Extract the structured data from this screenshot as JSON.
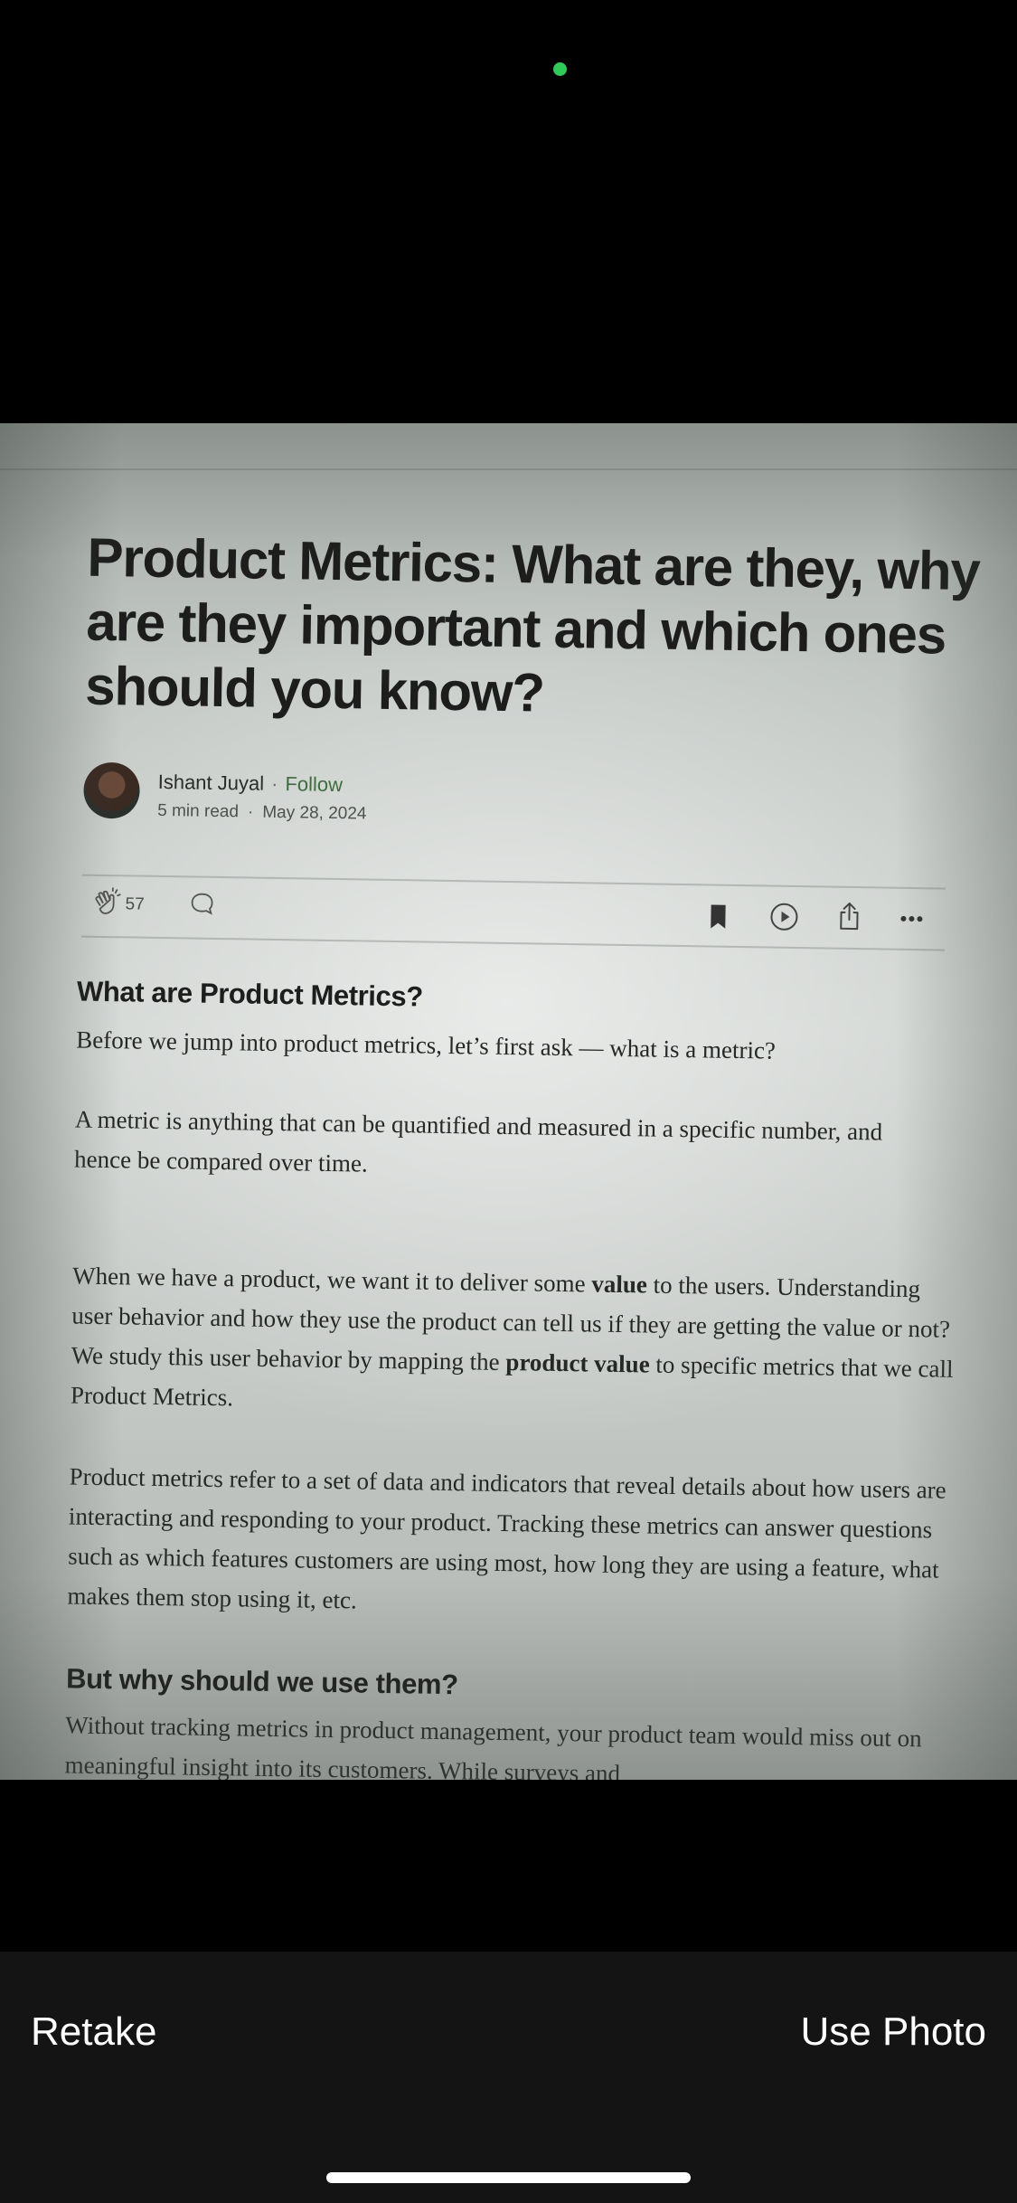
{
  "camera": {
    "indicator": "camera-in-use-indicator"
  },
  "article": {
    "title": "Product Metrics: What are they, why are they important and which ones should you know?",
    "author": "Ishant Juyal",
    "separator": "·",
    "follow_label": "Follow",
    "read_time": "5 min read",
    "date": "May 28, 2024",
    "clap_count": "57",
    "icons": {
      "clap": "clap-icon",
      "comment": "comment-icon",
      "bookmark": "bookmark-icon",
      "listen": "play-icon",
      "share": "share-icon",
      "more": "more-icon"
    },
    "sections": {
      "h1": "What are Product Metrics?",
      "p1": "Before we jump into product metrics, let’s first ask — what is a metric?",
      "p2": "A metric is anything that can be quantified and measured in a specific number, and hence be compared over time.",
      "p3_a": "When we have a product, we want it to deliver some ",
      "p3_b": "value",
      "p3_c": " to the users. Understanding user behavior and how they use the product can tell us if they are getting the value or not? We study this user behavior by mapping the ",
      "p3_d": "product value",
      "p3_e": " to specific metrics that we call Product Metrics.",
      "p4": "Product metrics refer to a set of data and indicators that reveal details about how users are interacting and responding to your product. Tracking these metrics can answer questions such as which features customers are using most, how long they are using a feature, what makes them stop using it, etc.",
      "h2": "But why should we use them?",
      "p5": "Without tracking metrics in product management, your product team would miss out on meaningful insight into its customers. While surveys and"
    }
  },
  "controls": {
    "retake_label": "Retake",
    "use_photo_label": "Use Photo"
  },
  "colors": {
    "indicator_green": "#31c95a",
    "bottom_bar": "#141414",
    "follow_green": "#3f6d3f"
  }
}
